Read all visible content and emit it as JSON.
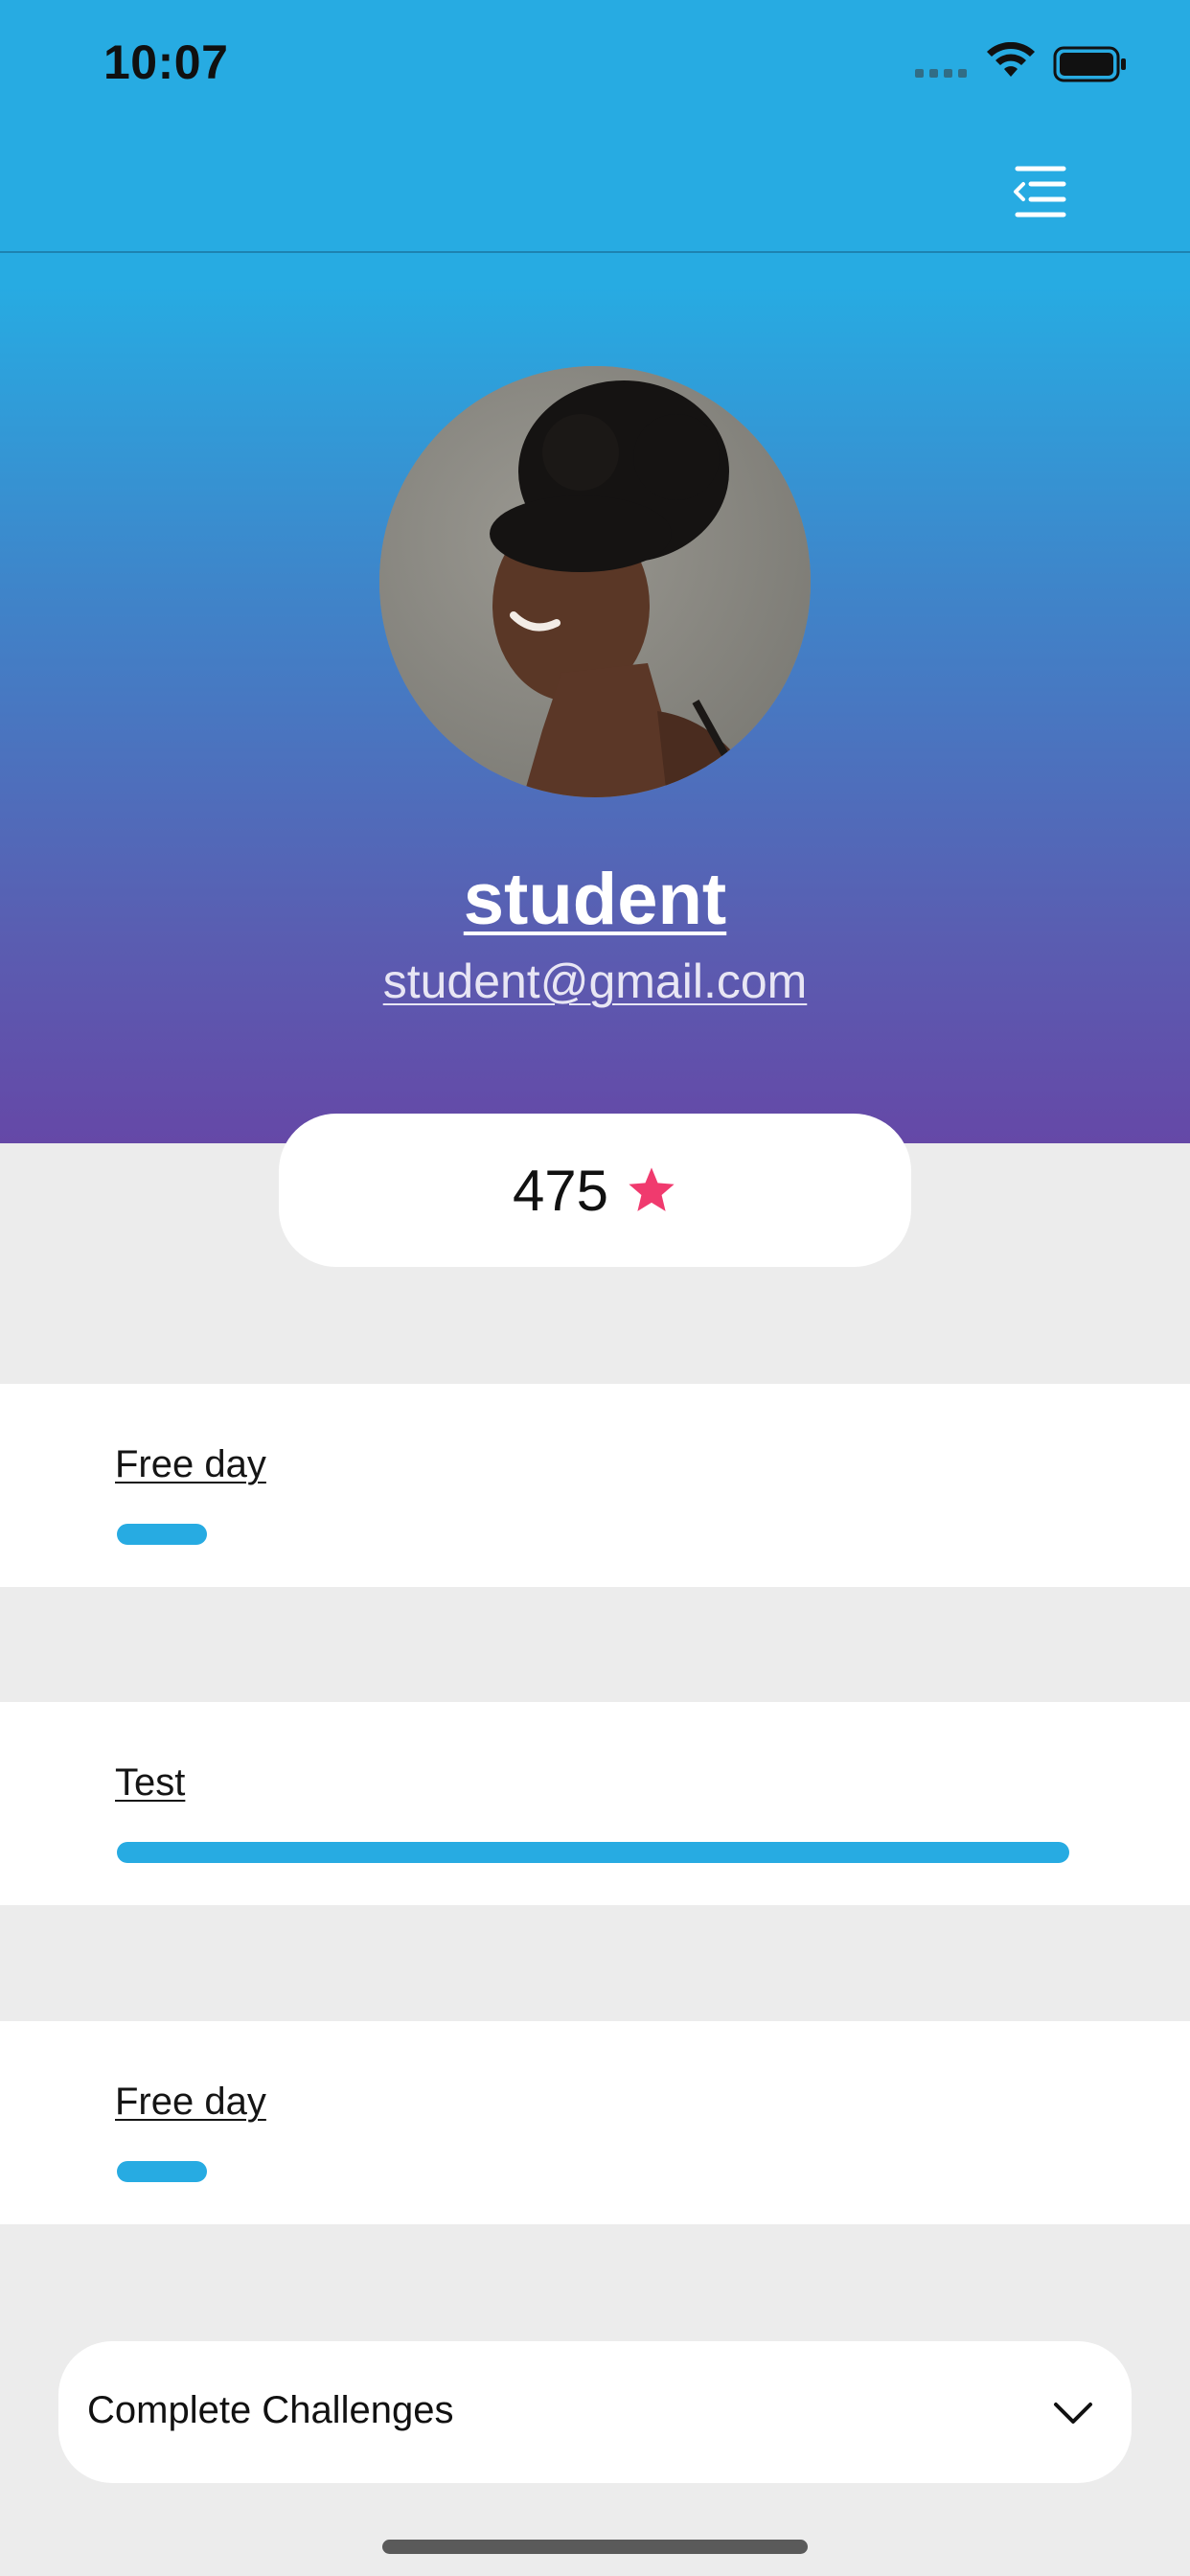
{
  "status_bar": {
    "time": "10:07"
  },
  "profile": {
    "name": "student",
    "email": "student@gmail.com",
    "points": "475"
  },
  "challenges": [
    {
      "title": "Free day",
      "progress": 0.095
    },
    {
      "title": "Test",
      "progress": 1.0
    },
    {
      "title": "Free day",
      "progress": 0.095
    }
  ],
  "dropdown": {
    "label": "Complete Challenges"
  },
  "icons": {
    "menu": "menu-collapse-icon",
    "star": "star-icon",
    "chevron": "chevron-down-icon"
  },
  "colors": {
    "accent": "#27abe2",
    "gradient_end": "#6548a7",
    "star": "#f03a6e"
  }
}
